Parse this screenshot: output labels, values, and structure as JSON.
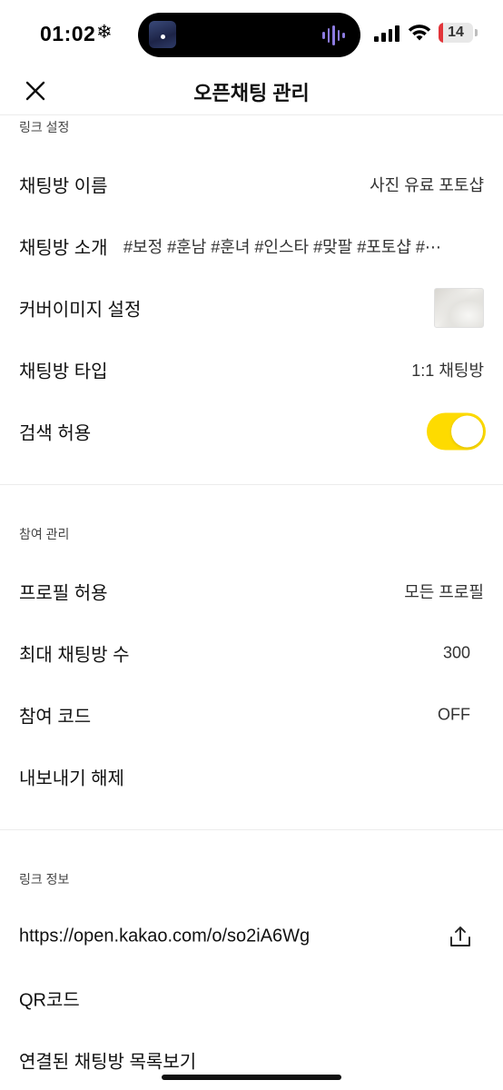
{
  "status_bar": {
    "time": "01:02",
    "snow_glyph": "❄",
    "battery_level": "14",
    "battery_fraction": 0.14,
    "battery_color": "#e2353a"
  },
  "nav": {
    "title": "오픈채팅 관리",
    "close_icon": "close-icon"
  },
  "sections": {
    "link_settings": {
      "header": "링크 설정",
      "name_label": "채팅방 이름",
      "name_value": "사진 유료 포토샵",
      "intro_label": "채팅방 소개",
      "intro_value": "#보정 #훈남 #훈녀 #인스타 #맞팔 #포토샵 #⋯",
      "cover_label": "커버이미지 설정",
      "type_label": "채팅방 타입",
      "type_value": "1:1 채팅방",
      "search_label": "검색 허용",
      "search_enabled": true,
      "toggle_color": "#fedb00"
    },
    "participation": {
      "header": "참여 관리",
      "profile_label": "프로필 허용",
      "profile_value": "모든 프로필",
      "max_label": "최대 채팅방 수",
      "max_value": "300",
      "code_label": "참여 코드",
      "code_value": "OFF",
      "export_label": "내보내기 해제"
    },
    "link_info": {
      "header": "링크 정보",
      "url": "https://open.kakao.com/o/so2iA6Wg",
      "share_icon": "share-icon",
      "qr_label": "QR코드",
      "linked_label": "연결된 채팅방 목록보기"
    }
  }
}
